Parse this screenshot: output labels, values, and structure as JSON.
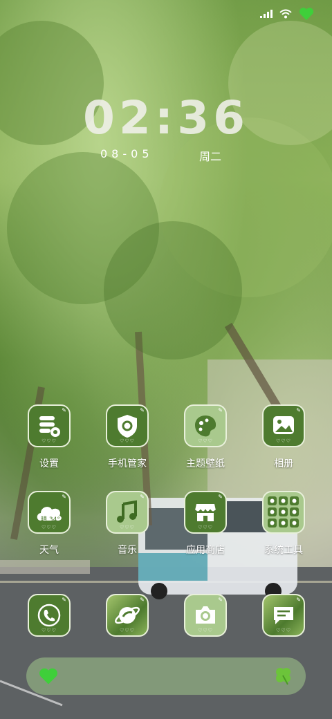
{
  "status_bar": {
    "icons": [
      "signal-icon",
      "wifi-icon",
      "heart-battery-icon"
    ]
  },
  "clock": {
    "time": "02:36",
    "date": "08-05",
    "weekday": "周二"
  },
  "apps": [
    {
      "label": "设置",
      "icon": "settings-icon"
    },
    {
      "label": "手机管家",
      "icon": "shield-icon"
    },
    {
      "label": "主题壁纸",
      "icon": "theme-icon"
    },
    {
      "label": "相册",
      "icon": "gallery-icon"
    },
    {
      "label": "天气",
      "icon": "weather-icon",
      "weather_text": "晴 34°"
    },
    {
      "label": "音乐",
      "icon": "music-icon"
    },
    {
      "label": "应用商店",
      "icon": "store-icon"
    },
    {
      "label": "系统工具",
      "icon": "folder-icon"
    }
  ],
  "dock_row": [
    {
      "icon": "phone-icon"
    },
    {
      "icon": "browser-icon"
    },
    {
      "icon": "camera-icon"
    },
    {
      "icon": "messages-icon"
    }
  ],
  "dock": {
    "left_icon": "heart-icon",
    "right_icon": "clover-icon"
  },
  "colors": {
    "icon_green": "#4e7b2f",
    "icon_light": "#a9c98d",
    "border": "#e8f0da"
  }
}
